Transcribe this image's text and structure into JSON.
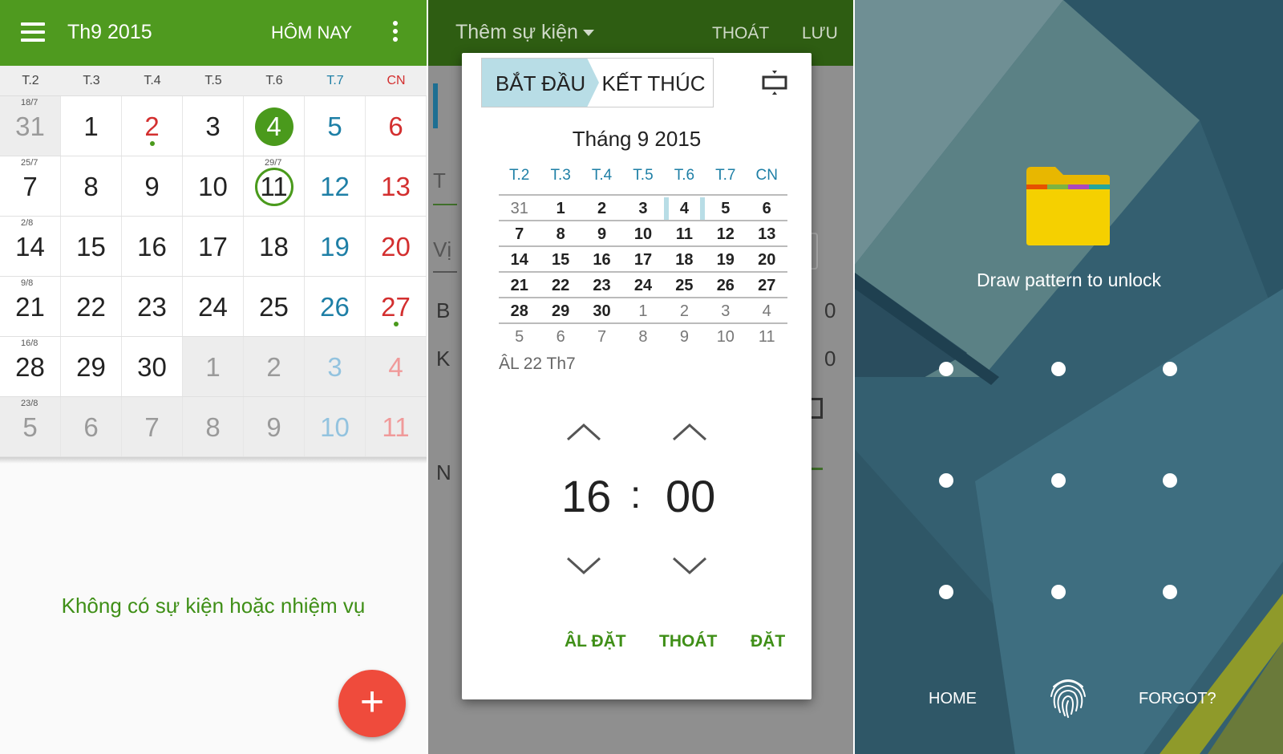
{
  "calendar": {
    "title": "Th9 2015",
    "today_button": "HÔM NAY",
    "weekdays": [
      "T.2",
      "T.3",
      "T.4",
      "T.5",
      "T.6",
      "T.7",
      "CN"
    ],
    "weeks": [
      {
        "lunar": "18/7",
        "days": [
          "31",
          "1",
          "2",
          "3",
          "4",
          "5",
          "6"
        ]
      },
      {
        "lunar": "25/7",
        "days": [
          "7",
          "8",
          "9",
          "10",
          "11",
          "12",
          "13"
        ],
        "lunar_extra": "29/7"
      },
      {
        "lunar": "2/8",
        "days": [
          "14",
          "15",
          "16",
          "17",
          "18",
          "19",
          "20"
        ]
      },
      {
        "lunar": "9/8",
        "days": [
          "21",
          "22",
          "23",
          "24",
          "25",
          "26",
          "27"
        ]
      },
      {
        "lunar": "16/8",
        "days": [
          "28",
          "29",
          "30",
          "1",
          "2",
          "3",
          "4"
        ]
      },
      {
        "lunar": "23/8",
        "days": [
          "5",
          "6",
          "7",
          "8",
          "9",
          "10",
          "11"
        ]
      }
    ],
    "empty_message": "Không có sự kiện hoặc nhiệm vụ",
    "fab": "+",
    "accent_color": "#4f9a1f"
  },
  "add_event": {
    "title": "Thêm sự kiện",
    "exit_button": "THOÁT",
    "save_button": "LƯU",
    "background_fragments": [
      "T",
      "Vị",
      "B",
      "K",
      "N",
      "0",
      "0"
    ],
    "dialog": {
      "tab_start": "BẮT ĐẦU",
      "tab_end": "KẾT THÚC",
      "month_title": "Tháng 9 2015",
      "weekdays": [
        "T.2",
        "T.3",
        "T.4",
        "T.5",
        "T.6",
        "T.7",
        "CN"
      ],
      "weeks": [
        [
          "31",
          "1",
          "2",
          "3",
          "4",
          "5",
          "6"
        ],
        [
          "7",
          "8",
          "9",
          "10",
          "11",
          "12",
          "13"
        ],
        [
          "14",
          "15",
          "16",
          "17",
          "18",
          "19",
          "20"
        ],
        [
          "21",
          "22",
          "23",
          "24",
          "25",
          "26",
          "27"
        ],
        [
          "28",
          "29",
          "30",
          "1",
          "2",
          "3",
          "4"
        ],
        [
          "5",
          "6",
          "7",
          "8",
          "9",
          "10",
          "11"
        ]
      ],
      "lunar_date": "ÂL 22 Th7",
      "hour": "16",
      "separator": ":",
      "minute": "00",
      "btn_lunar": "ÂL ĐẶT",
      "btn_cancel": "THOÁT",
      "btn_set": "ĐẶT"
    }
  },
  "lock_screen": {
    "message": "Draw pattern to unlock",
    "home_button": "HOME",
    "forgot_button": "FORGOT?",
    "icons": [
      "folder-icon",
      "fingerprint-icon"
    ]
  }
}
